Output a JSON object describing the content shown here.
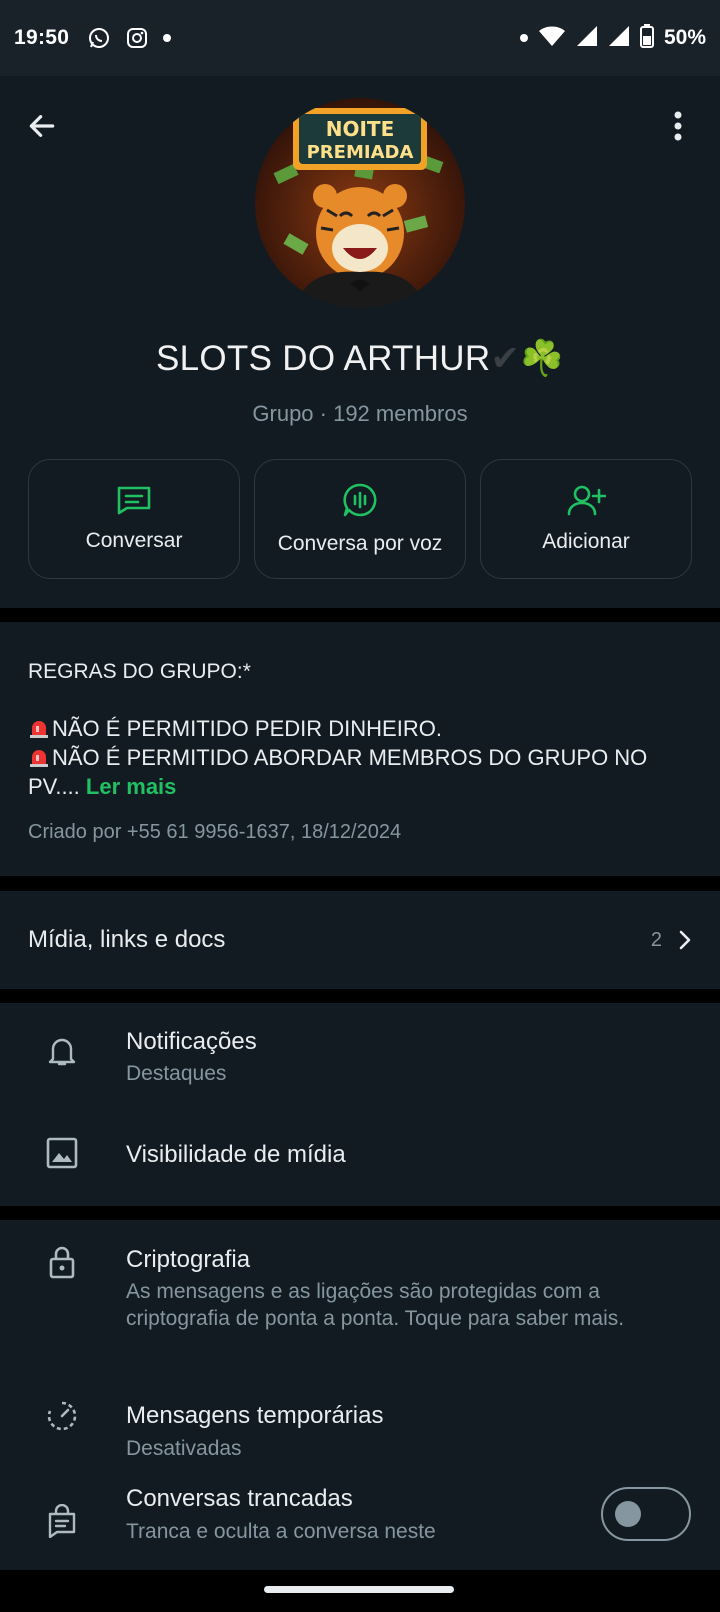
{
  "status_bar": {
    "time": "19:50",
    "battery": "50%"
  },
  "group": {
    "avatar_text_line1": "NOITE",
    "avatar_text_line2": "PREMIADA",
    "name": "SLOTS DO ARTHUR",
    "name_suffix": "✔",
    "name_emoji": "☘️",
    "subtitle": "Grupo · 192 membros"
  },
  "actions": [
    {
      "label": "Conversar",
      "icon": "message-icon"
    },
    {
      "label": "Conversa por voz",
      "icon": "voice-chat-icon"
    },
    {
      "label": "Adicionar",
      "icon": "add-person-icon"
    }
  ],
  "description": {
    "title": "REGRAS DO GRUPO:*",
    "rule1": "NÃO É PERMITIDO PEDIR DINHEIRO.",
    "rule2": "NÃO É PERMITIDO ABORDAR MEMBROS DO GRUPO NO PV....",
    "read_more": "Ler mais",
    "created": "Criado por +55 61 9956-1637, 18/12/2024"
  },
  "media": {
    "label": "Mídia, links e docs",
    "count": "2"
  },
  "settings": {
    "notifications_title": "Notificações",
    "notifications_sub": "Destaques",
    "media_visibility_title": "Visibilidade de mídia",
    "encryption_title": "Criptografia",
    "encryption_sub": "As mensagens e as ligações são protegidas com a criptografia de ponta a ponta. Toque para saber mais.",
    "temp_messages_title": "Mensagens temporárias",
    "temp_messages_sub": "Desativadas",
    "locked_chats_title": "Conversas trancadas",
    "locked_chats_sub": "Tranca e oculta a conversa neste"
  },
  "colors": {
    "accent_green": "#21c063",
    "background": "#111b21",
    "secondary_text": "#8696a0"
  }
}
